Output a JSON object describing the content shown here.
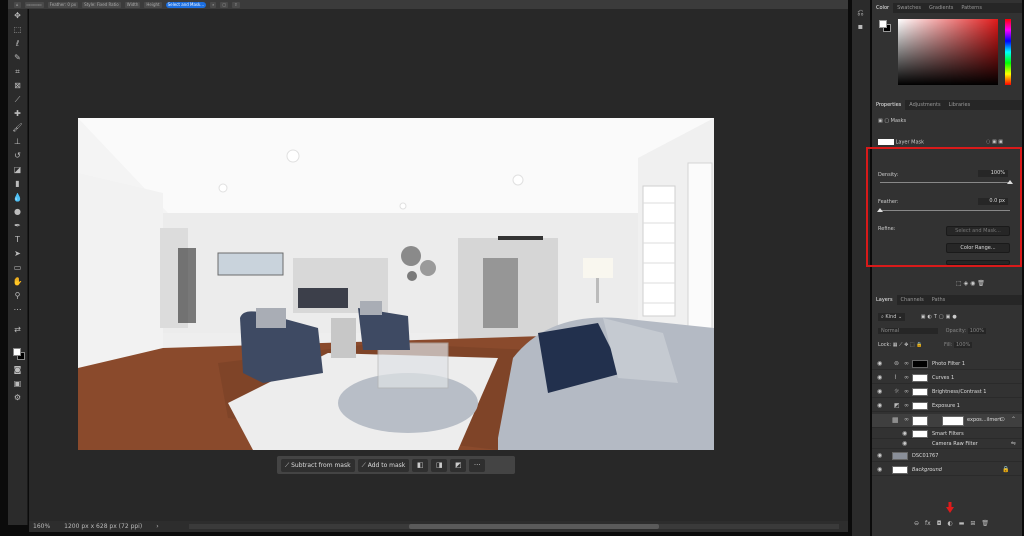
{
  "options_bar": {
    "items": [
      "Feather: 0 px",
      "Style: Fixed Ratio",
      "Width",
      "Height",
      "Select and Mask..."
    ]
  },
  "canvas": {
    "photo_alt": "Living room interior"
  },
  "context_bar": {
    "subtract_label": "Subtract from mask",
    "add_label": "Add to mask",
    "more_label": "···"
  },
  "status_bar": {
    "zoom": "160%",
    "doc_info": "1200 px x 628 px (72 ppi)"
  },
  "color_panel": {
    "tabs": [
      "Color",
      "Swatches",
      "Gradients",
      "Patterns"
    ]
  },
  "properties_panel": {
    "tabs": [
      "Properties",
      "Adjustments",
      "Libraries"
    ],
    "section_label": "Masks",
    "mask_label": "Layer Mask",
    "density_label": "Density:",
    "density_value": "100%",
    "density_fraction": 1.0,
    "feather_label": "Feather:",
    "feather_value": "0.0 px",
    "feather_fraction": 0.0,
    "refine_label": "Refine:",
    "select_and_mask_label": "Select and Mask...",
    "color_range_label": "Color Range..."
  },
  "layers_panel": {
    "tabs": [
      "Layers",
      "Channels",
      "Paths"
    ],
    "filter_label": "Kind",
    "blend_mode": "Normal",
    "opacity_label": "Opacity:",
    "opacity_value": "100%",
    "lock_label": "Lock:",
    "fill_label": "Fill:",
    "fill_value": "100%",
    "layers": [
      {
        "name": "Photo Filter 1"
      },
      {
        "name": "Curves 1"
      },
      {
        "name": "Brightness/Contrast 1"
      },
      {
        "name": "Exposure 1"
      },
      {
        "name": "expos...ilmert"
      },
      {
        "name": "Smart Filters"
      },
      {
        "name": "Camera Raw Filter"
      },
      {
        "name": "DSC01767"
      },
      {
        "name": "Background"
      }
    ]
  }
}
